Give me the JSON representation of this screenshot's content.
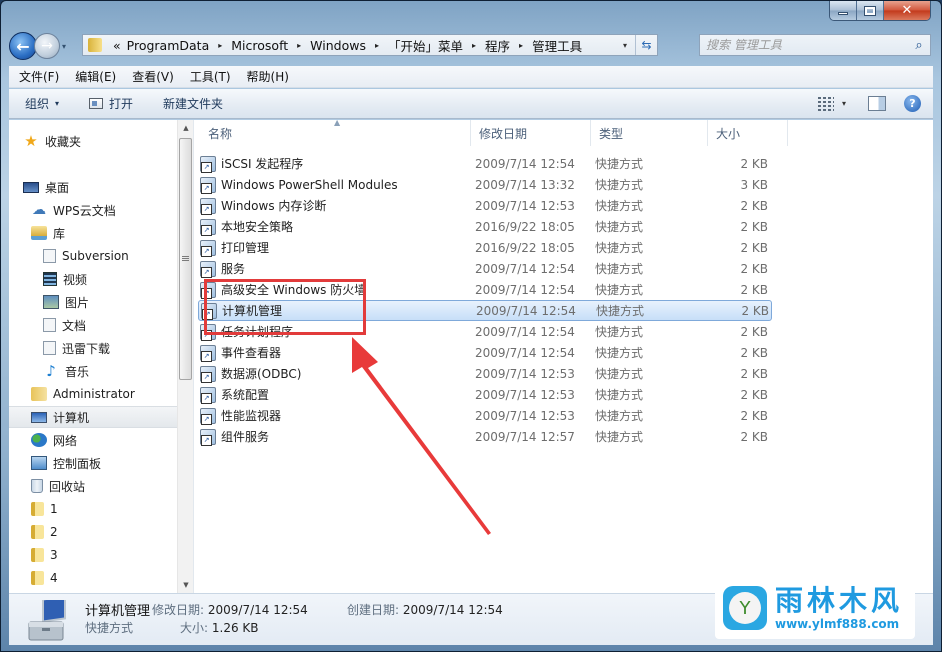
{
  "window": {
    "caption_buttons": {
      "minimize": "minimize",
      "maximize": "maximize",
      "close": "✕"
    }
  },
  "navigation": {
    "back_icon": "←",
    "forward_icon": "→",
    "history_dropdown_icon": "▾",
    "breadcrumb_overflow": "«",
    "breadcrumbs": [
      "ProgramData",
      "Microsoft",
      "Windows",
      "「开始」菜单",
      "程序",
      "管理工具"
    ],
    "separator": "▸",
    "address_dropdown_icon": "▾",
    "refresh_icon": "⇆",
    "search_placeholder": "搜索 管理工具",
    "search_icon": "⌕"
  },
  "menubar": {
    "items": [
      "文件(F)",
      "编辑(E)",
      "查看(V)",
      "工具(T)",
      "帮助(H)"
    ]
  },
  "toolbar": {
    "organize_label": "组织",
    "organize_caret": "▾",
    "open_label": "打开",
    "new_folder_label": "新建文件夹",
    "view_caret": "▾",
    "help_icon": "?"
  },
  "nav_pane": {
    "items": [
      {
        "label": "收藏夹",
        "icon": "star-icon",
        "glyph": "★",
        "level": 0
      },
      {
        "label": "桌面",
        "icon": "desktop-icon",
        "glyph": "",
        "level": 0
      },
      {
        "label": "WPS云文档",
        "icon": "cloud-icon",
        "glyph": "☁",
        "level": 1
      },
      {
        "label": "库",
        "icon": "library-icon",
        "glyph": "",
        "level": 1
      },
      {
        "label": "Subversion",
        "icon": "document-icon",
        "glyph": "",
        "level": 2
      },
      {
        "label": "视频",
        "icon": "video-icon",
        "glyph": "",
        "level": 2
      },
      {
        "label": "图片",
        "icon": "picture-icon",
        "glyph": "",
        "level": 2
      },
      {
        "label": "文档",
        "icon": "document-icon",
        "glyph": "",
        "level": 2
      },
      {
        "label": "迅雷下载",
        "icon": "document-icon",
        "glyph": "",
        "level": 2
      },
      {
        "label": "音乐",
        "icon": "music-icon",
        "glyph": "♪",
        "level": 2
      },
      {
        "label": "Administrator",
        "icon": "user-folder-icon",
        "glyph": "",
        "level": 1
      },
      {
        "label": "计算机",
        "icon": "computer-icon",
        "glyph": "",
        "level": 1,
        "selected": true
      },
      {
        "label": "网络",
        "icon": "network-icon",
        "glyph": "",
        "level": 1
      },
      {
        "label": "控制面板",
        "icon": "control-panel-icon",
        "glyph": "",
        "level": 1
      },
      {
        "label": "回收站",
        "icon": "recycle-bin-icon",
        "glyph": "",
        "level": 1
      },
      {
        "label": "1",
        "icon": "folder-icon",
        "glyph": "",
        "level": 1
      },
      {
        "label": "2",
        "icon": "folder-icon",
        "glyph": "",
        "level": 1
      },
      {
        "label": "3",
        "icon": "folder-icon",
        "glyph": "",
        "level": 1
      },
      {
        "label": "4",
        "icon": "folder-icon",
        "glyph": "",
        "level": 1
      }
    ],
    "scroll_up": "▲",
    "scroll_down": "▼"
  },
  "file_list": {
    "columns": {
      "name": "名称",
      "date": "修改日期",
      "type": "类型",
      "size": "大小"
    },
    "sort_indicator": "▲",
    "rows": [
      {
        "name": "iSCSI 发起程序",
        "date": "2009/7/14 12:54",
        "type": "快捷方式",
        "size": "2 KB"
      },
      {
        "name": "Windows PowerShell Modules",
        "date": "2009/7/14 13:32",
        "type": "快捷方式",
        "size": "3 KB"
      },
      {
        "name": "Windows 内存诊断",
        "date": "2009/7/14 12:53",
        "type": "快捷方式",
        "size": "2 KB"
      },
      {
        "name": "本地安全策略",
        "date": "2016/9/22 18:05",
        "type": "快捷方式",
        "size": "2 KB"
      },
      {
        "name": "打印管理",
        "date": "2016/9/22 18:05",
        "type": "快捷方式",
        "size": "2 KB"
      },
      {
        "name": "服务",
        "date": "2009/7/14 12:54",
        "type": "快捷方式",
        "size": "2 KB"
      },
      {
        "name": "高级安全 Windows 防火墙",
        "date": "2009/7/14 12:54",
        "type": "快捷方式",
        "size": "2 KB"
      },
      {
        "name": "计算机管理",
        "date": "2009/7/14 12:54",
        "type": "快捷方式",
        "size": "2 KB",
        "selected": true
      },
      {
        "name": "任务计划程序",
        "date": "2009/7/14 12:54",
        "type": "快捷方式",
        "size": "2 KB"
      },
      {
        "name": "事件查看器",
        "date": "2009/7/14 12:54",
        "type": "快捷方式",
        "size": "2 KB"
      },
      {
        "name": "数据源(ODBC)",
        "date": "2009/7/14 12:53",
        "type": "快捷方式",
        "size": "2 KB"
      },
      {
        "name": "系统配置",
        "date": "2009/7/14 12:53",
        "type": "快捷方式",
        "size": "2 KB"
      },
      {
        "name": "性能监视器",
        "date": "2009/7/14 12:53",
        "type": "快捷方式",
        "size": "2 KB"
      },
      {
        "name": "组件服务",
        "date": "2009/7/14 12:57",
        "type": "快捷方式",
        "size": "2 KB"
      }
    ]
  },
  "details_pane": {
    "name": "计算机管理",
    "modified_label": "修改日期:",
    "modified_value": "2009/7/14 12:54",
    "created_label": "创建日期:",
    "created_value": "2009/7/14 12:54",
    "type": "快捷方式",
    "size_label": "大小:",
    "size_value": "1.26 KB"
  },
  "annotation": {
    "color": "#e23b3b"
  },
  "watermark": {
    "title": "雨林木风",
    "url": "www.ylmf888.com",
    "logo_glyph": "Y",
    "color": "#1f9ae0"
  }
}
